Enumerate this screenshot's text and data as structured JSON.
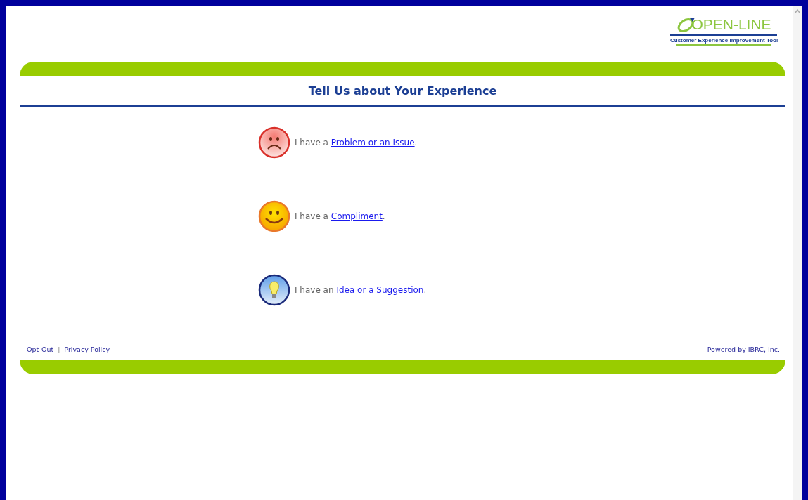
{
  "logo": {
    "name": "OPEN-LINE",
    "tagline": "Customer Experience Improvement Tool"
  },
  "title": "Tell Us about Your Experience",
  "options": [
    {
      "kind": "problem",
      "prefix": "I have a ",
      "link": "Problem or an Issue",
      "suffix": "."
    },
    {
      "kind": "compliment",
      "prefix": "I have a ",
      "link": "Compliment",
      "suffix": "."
    },
    {
      "kind": "idea",
      "prefix": "I have an ",
      "link": "Idea or a Suggestion",
      "suffix": "."
    }
  ],
  "footer": {
    "links": [
      "Opt-Out",
      "Privacy Policy"
    ],
    "separator": "|",
    "powered_by": "Powered by IBRC, Inc."
  }
}
